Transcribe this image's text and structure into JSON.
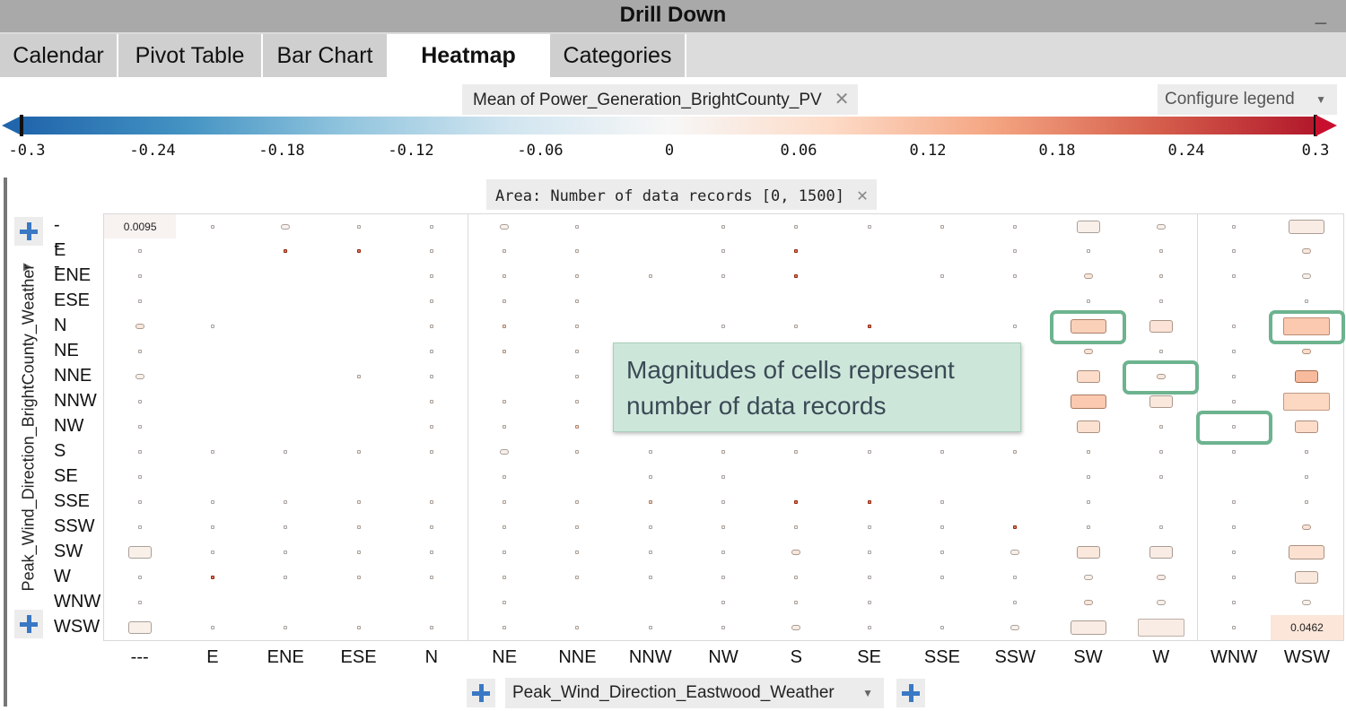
{
  "window": {
    "title": "Drill Down",
    "minimize_glyph": "_"
  },
  "tabs": [
    {
      "label": "Calendar",
      "active": false
    },
    {
      "label": "Pivot Table",
      "active": false
    },
    {
      "label": "Bar Chart",
      "active": false
    },
    {
      "label": "Heatmap",
      "active": true
    },
    {
      "label": "Categories",
      "active": false
    }
  ],
  "legend": {
    "series_label": "Mean of Power_Generation_BrightCounty_PV",
    "close_glyph": "✕",
    "configure_label": "Configure legend",
    "caret": "▼",
    "ticks": [
      "-0.3",
      "-0.24",
      "-0.18",
      "-0.12",
      "-0.06",
      "0",
      "0.06",
      "0.12",
      "0.18",
      "0.24",
      "0.3"
    ],
    "range": [
      -0.3,
      0.3
    ],
    "colors": [
      "#2166ac",
      "#4393c3",
      "#92c5de",
      "#d1e5f0",
      "#f7f7f7",
      "#fddbc7",
      "#f4a582",
      "#d6604d",
      "#b2182b"
    ]
  },
  "area_filter": {
    "label": "Area:  Number of data records [0, 1500]",
    "close_glyph": "✕",
    "range": [
      0,
      1500
    ]
  },
  "y_axis": {
    "label": "Peak_Wind_Direction_BrightCounty_Weather",
    "caret": "▶"
  },
  "x_axis": {
    "label": "Peak_Wind_Direction_Eastwood_Weather",
    "caret": "▼"
  },
  "annotation": {
    "line1": "Magnitudes of cells represent",
    "line2": "number of data records"
  },
  "chart_data": {
    "type": "heatmap",
    "rows": [
      "---",
      "E",
      "ENE",
      "ESE",
      "N",
      "NE",
      "NNE",
      "NNW",
      "NW",
      "S",
      "SE",
      "SSE",
      "SSW",
      "SW",
      "W",
      "WNW",
      "WSW"
    ],
    "columns": [
      "---",
      "E",
      "ENE",
      "ESE",
      "N",
      "NE",
      "NNE",
      "NNW",
      "NW",
      "S",
      "SE",
      "SSE",
      "SSW",
      "SW",
      "W",
      "WNW",
      "WSW"
    ],
    "cell_format": "[mean value, record size level 1-5 (5 = full cell), or null when empty]",
    "cells": [
      [
        [
          0.0095,
          5
        ],
        [
          0.02,
          1
        ],
        [
          0.015,
          2
        ],
        [
          0.02,
          1
        ],
        [
          0.01,
          1
        ],
        [
          0.02,
          2
        ],
        [
          0.01,
          1
        ],
        null,
        [
          0.02,
          1
        ],
        [
          0.02,
          1
        ],
        [
          0.01,
          1
        ],
        [
          0.02,
          1
        ],
        [
          0.01,
          1
        ],
        [
          0.02,
          3
        ],
        [
          0.02,
          2
        ],
        [
          0.01,
          1
        ],
        [
          0.03,
          4
        ]
      ],
      [
        [
          0.01,
          1
        ],
        null,
        [
          0.2,
          1
        ],
        [
          0.2,
          1
        ],
        [
          0.02,
          1
        ],
        [
          0.03,
          1
        ],
        [
          0.02,
          1
        ],
        null,
        [
          0.01,
          1
        ],
        [
          0.2,
          1
        ],
        null,
        null,
        [
          0.01,
          1
        ],
        [
          0.01,
          1
        ],
        [
          0.02,
          1
        ],
        [
          0.01,
          1
        ],
        [
          0.04,
          2
        ]
      ],
      [
        [
          0.01,
          1
        ],
        null,
        null,
        null,
        [
          0.02,
          1
        ],
        [
          0.03,
          1
        ],
        [
          0.02,
          1
        ],
        [
          0.02,
          1
        ],
        [
          0.01,
          1
        ],
        [
          0.2,
          1
        ],
        null,
        [
          0.01,
          1
        ],
        [
          0.01,
          1
        ],
        [
          0.04,
          2
        ],
        [
          0.02,
          1
        ],
        [
          0.01,
          1
        ],
        [
          0.02,
          2
        ]
      ],
      [
        [
          0.01,
          1
        ],
        null,
        null,
        null,
        [
          0.02,
          1
        ],
        [
          0.03,
          1
        ],
        [
          0.02,
          1
        ],
        null,
        null,
        null,
        null,
        null,
        null,
        [
          0.01,
          1
        ],
        [
          0.01,
          1
        ],
        null,
        [
          0.01,
          1
        ]
      ],
      [
        [
          0.04,
          2
        ],
        [
          0.01,
          1
        ],
        null,
        null,
        [
          0.02,
          1
        ],
        [
          0.08,
          1
        ],
        [
          0.02,
          1
        ],
        null,
        [
          0.01,
          1
        ],
        [
          0.02,
          1
        ],
        [
          0.2,
          1
        ],
        null,
        [
          0.01,
          1
        ],
        [
          0.09,
          4
        ],
        [
          0.05,
          3
        ],
        [
          0.01,
          1
        ],
        [
          0.1,
          5
        ]
      ],
      [
        [
          0.02,
          1
        ],
        null,
        null,
        null,
        [
          0.02,
          1
        ],
        [
          0.06,
          1
        ],
        [
          0.02,
          1
        ],
        null,
        null,
        null,
        null,
        null,
        null,
        [
          0.05,
          2
        ],
        [
          0.02,
          1
        ],
        [
          0.01,
          1
        ],
        [
          0.07,
          2
        ]
      ],
      [
        [
          0.02,
          2
        ],
        null,
        null,
        [
          0.03,
          1
        ],
        [
          0.02,
          1
        ],
        null,
        [
          0.02,
          1
        ],
        null,
        null,
        null,
        null,
        null,
        null,
        [
          0.07,
          3
        ],
        [
          0.04,
          2
        ],
        [
          0.01,
          1
        ],
        [
          0.12,
          3
        ]
      ],
      [
        [
          0.01,
          1
        ],
        null,
        null,
        null,
        [
          0.02,
          1
        ],
        [
          0.03,
          1
        ],
        [
          0.02,
          1
        ],
        null,
        null,
        null,
        null,
        null,
        null,
        [
          0.1,
          4
        ],
        [
          0.04,
          3
        ],
        [
          0.01,
          1
        ],
        [
          0.08,
          5
        ]
      ],
      [
        [
          0.01,
          1
        ],
        null,
        null,
        null,
        [
          0.02,
          1
        ],
        [
          0.03,
          1
        ],
        [
          0.08,
          1
        ],
        null,
        null,
        null,
        null,
        null,
        null,
        [
          0.06,
          3
        ],
        [
          0.02,
          1
        ],
        [
          0.01,
          1
        ],
        [
          0.07,
          3
        ]
      ],
      [
        [
          0.01,
          1
        ],
        [
          0.01,
          1
        ],
        [
          0.01,
          1
        ],
        [
          0.02,
          1
        ],
        [
          0.02,
          1
        ],
        [
          0.02,
          2
        ],
        [
          0.02,
          1
        ],
        [
          0.01,
          1
        ],
        [
          0.02,
          1
        ],
        [
          0.02,
          1
        ],
        [
          0.01,
          1
        ],
        [
          0.01,
          1
        ],
        [
          0.02,
          1
        ],
        [
          0.02,
          1
        ],
        [
          0.01,
          1
        ],
        [
          0.01,
          1
        ],
        [
          0.02,
          1
        ]
      ],
      [
        [
          0.01,
          1
        ],
        null,
        null,
        null,
        null,
        [
          0.02,
          1
        ],
        null,
        [
          0.01,
          1
        ],
        [
          0.01,
          1
        ],
        null,
        null,
        null,
        null,
        [
          0.01,
          1
        ],
        [
          0.01,
          1
        ],
        null,
        [
          0.01,
          1
        ]
      ],
      [
        [
          0.01,
          1
        ],
        [
          0.01,
          1
        ],
        [
          0.01,
          1
        ],
        [
          0.02,
          1
        ],
        [
          0.02,
          1
        ],
        [
          0.02,
          1
        ],
        [
          0.02,
          1
        ],
        [
          0.09,
          1
        ],
        [
          0.01,
          1
        ],
        [
          0.2,
          1
        ],
        [
          0.2,
          1
        ],
        [
          0.01,
          1
        ],
        null,
        [
          0.01,
          1
        ],
        null,
        [
          0.01,
          1
        ],
        [
          0.02,
          1
        ]
      ],
      [
        [
          0.01,
          1
        ],
        [
          0.01,
          1
        ],
        [
          0.01,
          1
        ],
        [
          0.02,
          1
        ],
        [
          0.02,
          1
        ],
        [
          0.02,
          1
        ],
        [
          0.02,
          1
        ],
        [
          0.01,
          1
        ],
        [
          0.02,
          1
        ],
        [
          0.02,
          1
        ],
        [
          0.01,
          1
        ],
        [
          0.01,
          1
        ],
        [
          0.2,
          1
        ],
        [
          0.02,
          1
        ],
        [
          0.01,
          1
        ],
        [
          0.01,
          1
        ],
        [
          0.05,
          2
        ]
      ],
      [
        [
          0.02,
          3
        ],
        [
          0.01,
          1
        ],
        [
          0.01,
          1
        ],
        [
          0.02,
          1
        ],
        [
          0.02,
          1
        ],
        [
          0.02,
          1
        ],
        [
          0.02,
          1
        ],
        [
          0.01,
          1
        ],
        [
          0.01,
          1
        ],
        [
          0.04,
          2
        ],
        [
          0.01,
          1
        ],
        [
          0.01,
          1
        ],
        [
          0.02,
          2
        ],
        [
          0.04,
          3
        ],
        [
          0.03,
          3
        ],
        [
          0.01,
          1
        ],
        [
          0.06,
          4
        ]
      ],
      [
        [
          0.01,
          1
        ],
        [
          0.2,
          1
        ],
        [
          0.01,
          1
        ],
        [
          0.02,
          1
        ],
        [
          0.02,
          1
        ],
        [
          0.02,
          1
        ],
        [
          0.02,
          1
        ],
        [
          0.01,
          1
        ],
        [
          0.01,
          1
        ],
        [
          0.02,
          1
        ],
        [
          0.01,
          1
        ],
        [
          0.01,
          1
        ],
        [
          0.01,
          1
        ],
        [
          0.02,
          2
        ],
        [
          0.03,
          2
        ],
        [
          0.01,
          1
        ],
        [
          0.04,
          3
        ]
      ],
      [
        [
          0.01,
          1
        ],
        null,
        null,
        null,
        null,
        [
          0.02,
          1
        ],
        null,
        null,
        [
          0.01,
          1
        ],
        [
          0.02,
          1
        ],
        [
          0.01,
          1
        ],
        null,
        [
          0.01,
          1
        ],
        [
          0.04,
          2
        ],
        [
          0.02,
          2
        ],
        [
          0.01,
          1
        ],
        [
          0.02,
          2
        ]
      ],
      [
        [
          0.02,
          3
        ],
        [
          0.01,
          1
        ],
        [
          0.01,
          1
        ],
        [
          0.02,
          1
        ],
        [
          0.02,
          1
        ],
        [
          0.02,
          1
        ],
        [
          0.02,
          1
        ],
        [
          0.01,
          1
        ],
        [
          0.01,
          1
        ],
        [
          0.03,
          2
        ],
        [
          0.01,
          1
        ],
        [
          0.01,
          1
        ],
        [
          0.02,
          2
        ],
        [
          0.03,
          4
        ],
        [
          0.03,
          5
        ],
        [
          0.01,
          1
        ],
        [
          0.0462,
          5
        ]
      ]
    ],
    "value_labels": [
      {
        "row": 0,
        "col": 0,
        "text": "0.0095"
      },
      {
        "row": 16,
        "col": 16,
        "text": "0.0462"
      }
    ],
    "highlighted_cells": [
      {
        "row": 4,
        "col": 13
      },
      {
        "row": 4,
        "col": 16
      },
      {
        "row": 6,
        "col": 14
      },
      {
        "row": 8,
        "col": 15
      }
    ]
  }
}
